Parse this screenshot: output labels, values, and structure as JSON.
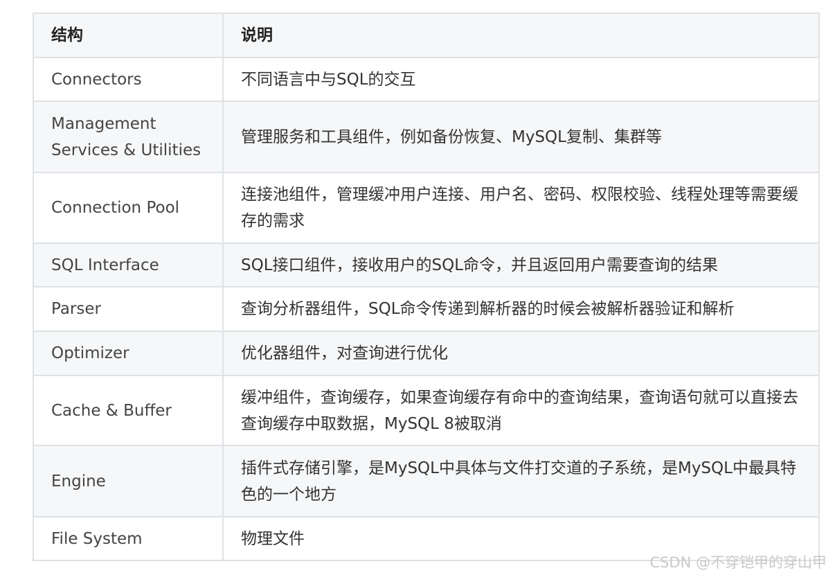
{
  "table": {
    "headers": [
      "结构",
      "说明"
    ],
    "rows": [
      {
        "name": "Connectors",
        "desc": "不同语言中与SQL的交互"
      },
      {
        "name": "Management Services & Utilities",
        "desc": "管理服务和工具组件，例如备份恢复、MySQL复制、集群等"
      },
      {
        "name": "Connection Pool",
        "desc": "连接池组件，管理缓冲用户连接、用户名、密码、权限校验、线程处理等需要缓存的需求"
      },
      {
        "name": "SQL Interface",
        "desc": "SQL接口组件，接收用户的SQL命令，并且返回用户需要查询的结果"
      },
      {
        "name": "Parser",
        "desc": "查询分析器组件，SQL命令传递到解析器的时候会被解析器验证和解析"
      },
      {
        "name": "Optimizer",
        "desc": "优化器组件，对查询进行优化"
      },
      {
        "name": "Cache & Buffer",
        "desc": "缓冲组件，查询缓存，如果查询缓存有命中的查询结果，查询语句就可以直接去查询缓存中取数据，MySQL 8被取消"
      },
      {
        "name": "Engine",
        "desc": "插件式存储引擎，是MySQL中具体与文件打交道的子系统，是MySQL中最具特色的一个地方"
      },
      {
        "name": "File System",
        "desc": "物理文件"
      }
    ]
  },
  "watermark": "CSDN @不穿铠甲的穿山甲"
}
